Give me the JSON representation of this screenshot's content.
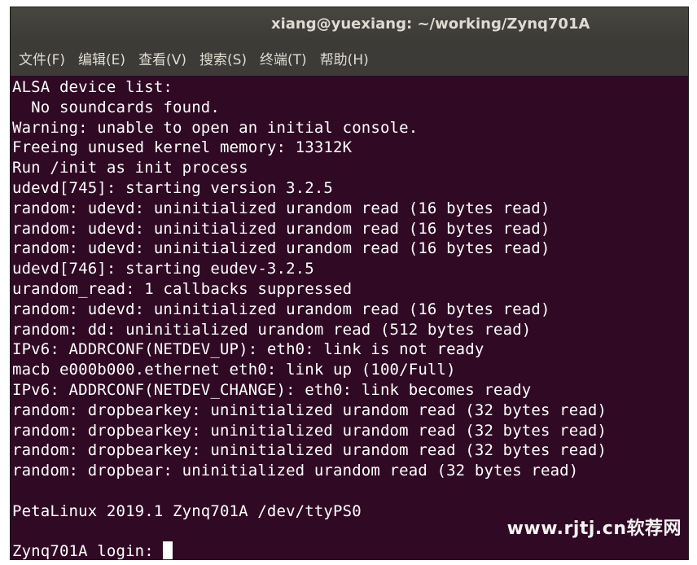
{
  "window": {
    "title": "xiang@yuexiang: ~/working/Zynq701A"
  },
  "menubar": {
    "items": [
      {
        "label": "文件(F)"
      },
      {
        "label": "编辑(E)"
      },
      {
        "label": "查看(V)"
      },
      {
        "label": "搜索(S)"
      },
      {
        "label": "终端(T)"
      },
      {
        "label": "帮助(H)"
      }
    ]
  },
  "terminal": {
    "lines": [
      "ALSA device list:",
      "  No soundcards found.",
      "Warning: unable to open an initial console.",
      "Freeing unused kernel memory: 13312K",
      "Run /init as init process",
      "udevd[745]: starting version 3.2.5",
      "random: udevd: uninitialized urandom read (16 bytes read)",
      "random: udevd: uninitialized urandom read (16 bytes read)",
      "random: udevd: uninitialized urandom read (16 bytes read)",
      "udevd[746]: starting eudev-3.2.5",
      "urandom_read: 1 callbacks suppressed",
      "random: udevd: uninitialized urandom read (16 bytes read)",
      "random: dd: uninitialized urandom read (512 bytes read)",
      "IPv6: ADDRCONF(NETDEV_UP): eth0: link is not ready",
      "macb e000b000.ethernet eth0: link up (100/Full)",
      "IPv6: ADDRCONF(NETDEV_CHANGE): eth0: link becomes ready",
      "random: dropbearkey: uninitialized urandom read (32 bytes read)",
      "random: dropbearkey: uninitialized urandom read (32 bytes read)",
      "random: dropbearkey: uninitialized urandom read (32 bytes read)",
      "random: dropbear: uninitialized urandom read (32 bytes read)",
      "",
      "PetaLinux 2019.1 Zynq701A /dev/ttyPS0",
      ""
    ],
    "prompt": "Zynq701A login: "
  },
  "watermark": {
    "text": "www.rjtj.cn软荐网"
  },
  "colors": {
    "terminal_bg": "#300a24",
    "terminal_fg": "#ffffff",
    "titlebar_bg": "#3c3b37",
    "titlebar_fg": "#dfdbd2"
  }
}
